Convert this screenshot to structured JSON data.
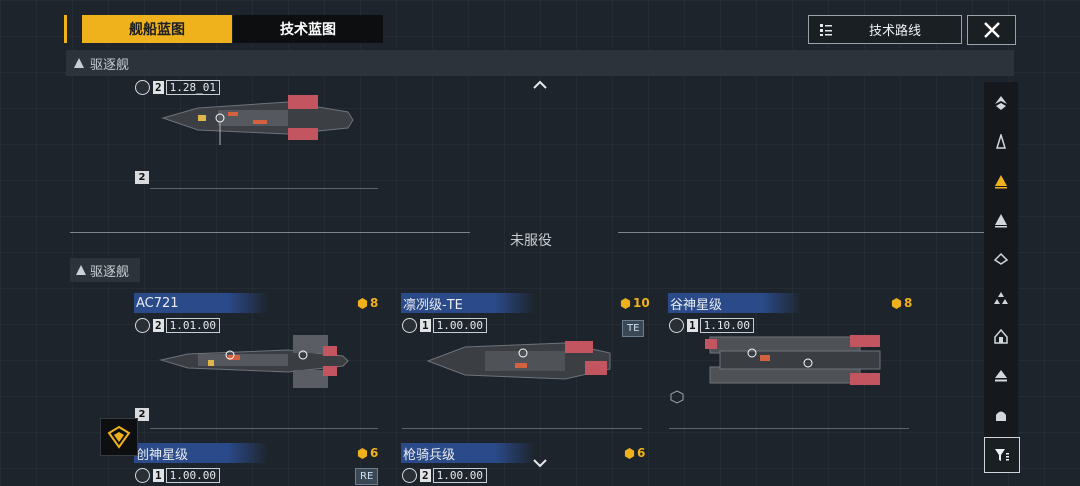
{
  "tabs": [
    {
      "label": "舰船蓝图",
      "active": true
    },
    {
      "label": "技术蓝图",
      "active": false
    }
  ],
  "header": {
    "route_label": "技术路线",
    "close_icon": "close-icon"
  },
  "category_bar": {
    "label": "驱逐舰"
  },
  "section": {
    "label": "未服役"
  },
  "group": {
    "label": "驱逐舰"
  },
  "top_card": {
    "level": "2",
    "version": "1.28_01",
    "slot": "2"
  },
  "cards": [
    {
      "name": "AC721",
      "cost": "8",
      "level": "2",
      "version": "1.01.00",
      "slot": "2"
    },
    {
      "name": "凛冽级-TE",
      "cost": "10",
      "level": "1",
      "version": "1.00.00",
      "badge": "TE"
    },
    {
      "name": "谷神星级",
      "cost": "8",
      "level": "1",
      "version": "1.10.00"
    },
    {
      "name": "创神星级",
      "cost": "6",
      "level": "1",
      "version": "1.00.00",
      "badge": "RE"
    },
    {
      "name": "枪骑兵级",
      "cost": "6",
      "level": "2",
      "version": "1.00.00"
    }
  ],
  "side_nav": [
    "frigate-icon",
    "destroyer-light-icon",
    "destroyer-icon",
    "cruiser-icon",
    "battlecruiser-icon",
    "carrier-icon",
    "battleship-icon",
    "dreadnought-icon",
    "capital-icon",
    "filter-icon"
  ],
  "colors": {
    "accent": "#f0b21c",
    "name_bar": "#2a4a8a",
    "background": "#1e242b"
  }
}
